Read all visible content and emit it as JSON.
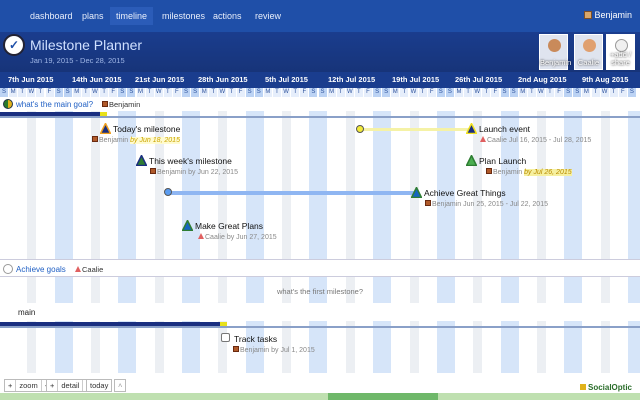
{
  "nav": {
    "items": [
      "dashboard",
      "plans",
      "timeline",
      "milestones",
      "actions",
      "review"
    ],
    "active": "timeline",
    "user": "Benjamin"
  },
  "project": {
    "title": "Milestone Planner",
    "dates": "Jan 19, 2015 - Dec 28, 2015"
  },
  "people": [
    {
      "label": "Benjamin"
    },
    {
      "label": "Caalie"
    },
    {
      "label": "+add / share"
    }
  ],
  "weeks": [
    "7th Jun 2015",
    "14th Jun 2015",
    "21st Jun 2015",
    "28th Jun 2015",
    "5th Jul 2015",
    "12th Jul 2015",
    "19th Jul 2015",
    "26th Jul 2015",
    "2nd Aug 2015",
    "9th Aug 2015"
  ],
  "day_letters": [
    "S",
    "M",
    "T",
    "W",
    "T",
    "F",
    "S"
  ],
  "goal": {
    "title": "what's the main goal?",
    "owner": "Benjamin"
  },
  "milestones": [
    {
      "title": "Today's milestone",
      "owner": "Benjamin",
      "due": "by Jun 18, 2015",
      "color": "#1a2f80"
    },
    {
      "title": "This week's milestone",
      "owner": "Benjamin",
      "due": "by Jun 22, 2015",
      "color": "#2e7d32"
    },
    {
      "title": "Make Great Plans",
      "owner": "Caalie",
      "due": "by Jun 27, 2015",
      "color": "#1565c0"
    },
    {
      "title": "Launch event",
      "owner": "Caalie",
      "due": "Jul 16, 2015 - Jul 28, 2015",
      "color": "#1a2f80"
    },
    {
      "title": "Plan Launch",
      "owner": "Benjamin",
      "due": "by Jul 26, 2015",
      "color": "#2e7d32"
    },
    {
      "title": "Achieve Great Things",
      "owner": "Benjamin",
      "due": "Jun 25, 2015 - Jul 22, 2015",
      "color": "#1565c0"
    }
  ],
  "achieve": {
    "title": "Achieve goals",
    "owner": "Caalie"
  },
  "first_question": "what's the first milestone?",
  "main_row": "main",
  "task": {
    "title": "Track tasks",
    "owner": "Benjamin",
    "due": "by Jul 1, 2015"
  },
  "toolbar": {
    "zoom": "zoom",
    "detail": "detail",
    "today": "today",
    "minus": "-",
    "plus": "+"
  },
  "brand": "SocialOptic"
}
